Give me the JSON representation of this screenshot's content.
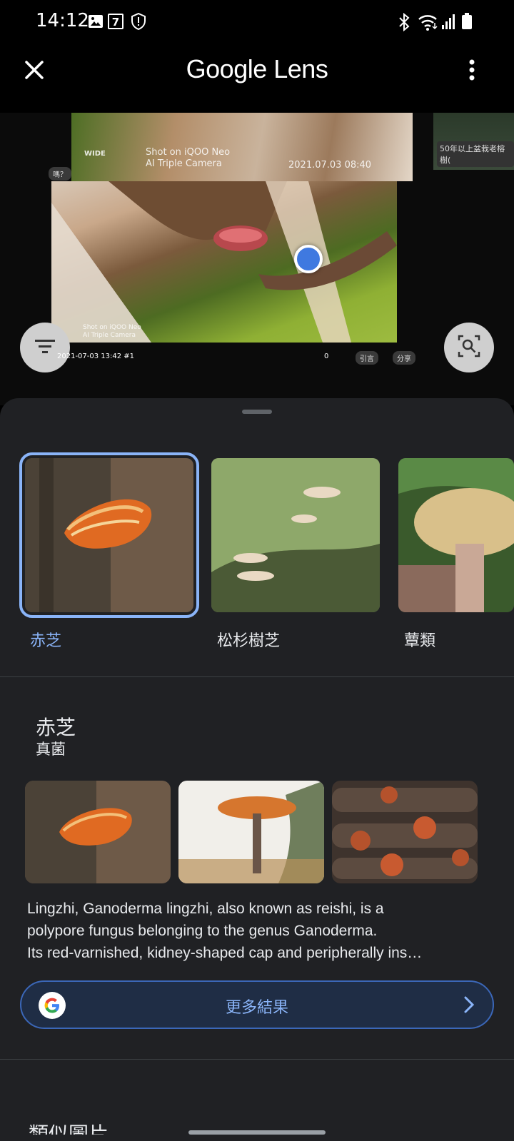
{
  "status_bar": {
    "time": "14:12",
    "icons": [
      "image-icon",
      "seven-eleven-icon",
      "shield-alert-icon",
      "bluetooth-icon",
      "wifi-icon",
      "signal-icon",
      "battery-icon"
    ]
  },
  "app_bar": {
    "title_brand": "Google",
    "title_product": "Lens",
    "close_icon": "close-icon",
    "menu_icon": "more-vert-icon"
  },
  "capture": {
    "overlay_top_left": "WIDE",
    "overlay_shot_line1": "Shot on iQOO Neo",
    "overlay_shot_line2": "AI Triple Camera",
    "overlay_date_top": "2021.07.03 08:40",
    "tag_question": "嗎？",
    "side_caption": "50年以上盆栽老榕樹(",
    "inner_shot_line1": "Shot on iQOO Neo",
    "inner_shot_line2": "AI Triple Camera",
    "post_date": "2021-07-03 13:42 #1",
    "like_count": "0",
    "quote_label": "引言",
    "share_label": "分享"
  },
  "matches": [
    {
      "label": "赤芝",
      "selected": true
    },
    {
      "label": "松杉樹芝",
      "selected": false
    },
    {
      "label": "蕈類",
      "selected": false
    }
  ],
  "result": {
    "title": "赤芝",
    "subtitle": "真菌",
    "description_lines": [
      "Lingzhi, Ganoderma lingzhi, also known as reishi, is a",
      "polypore fungus belonging to the genus Ganoderma.",
      "Its red-varnished, kidney-shaped cap and peripherally ins…"
    ],
    "more_button_label": "更多結果"
  },
  "next_section_title": "類似圖片",
  "colors": {
    "accent": "#8ab4f8",
    "sheet_bg": "#202124",
    "dot": "#3f79e0"
  }
}
